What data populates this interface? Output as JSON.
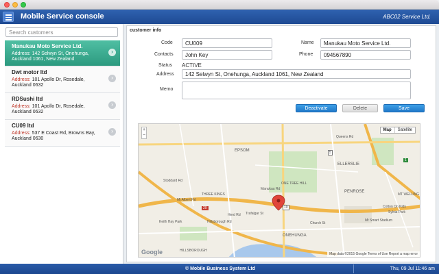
{
  "app": {
    "title": "Mobile Service console",
    "company": "ABC02 Service Ltd."
  },
  "sidebar": {
    "search_placeholder": "Search customers",
    "address_label": "Address:",
    "customers": [
      {
        "name": "Manukau Moto Service Ltd.",
        "address": "142 Selwyn St, Onehunga, Auckland 1061, New Zealand"
      },
      {
        "name": "Dwt motor ltd",
        "address": "101 Apollo Dr, Rosedale, Auckland 0632"
      },
      {
        "name": "RDSushi ltd",
        "address": "101 Apollo Dr, Rosedale, Auckland 0632"
      },
      {
        "name": "CU09 ltd",
        "address": "537 E Coast Rd, Browns Bay, Auckland 0630"
      }
    ]
  },
  "customer_info": {
    "section_title": "customer info",
    "code_label": "Code",
    "code": "CU009",
    "name_label": "Name",
    "name": "Manukau Moto Service Ltd.",
    "contacts_label": "Contacts",
    "contacts": "John Key",
    "phone_label": "Phone",
    "phone": "094567890",
    "status_label": "Status",
    "status": "ACTIVE",
    "address_label": "Address",
    "address": "142 Selwyn St, Onehunga, Auckland 1061, New Zealand",
    "memo_label": "Memo",
    "memo": ""
  },
  "actions": {
    "deactivate": "Deactivate",
    "delete": "Delete",
    "save": "Save"
  },
  "map": {
    "type_map": "Map",
    "type_satellite": "Satellite",
    "zoom_in": "+",
    "zoom_out": "−",
    "google": "Google",
    "footer": "Map data ©2015 Google   Terms of Use   Report a map error",
    "labels": {
      "epsom": "EPSOM",
      "ellerslie": "ELLERSLIE",
      "onehunga": "ONEHUNGA",
      "penrose": "PENROSE",
      "one_tree_hill": "ONE TREE HILL",
      "three_kings": "THREE KINGS",
      "hillsborough": "HILLSBOROUGH",
      "mt_smart": "Mt Smart Stadium",
      "cotton_on": "Cotton On Kids",
      "sylvia_park": "Sylvia Park",
      "mt_wellington": "MT WELLING",
      "keith_hay_park": "Keith Hay Park",
      "manukau_rd": "Manukau Rd",
      "queens_rd": "Queens Rd",
      "mt_albert_rd": "Mt Albert Rd",
      "hillsborough_rd": "Hillsborough Rd",
      "trafalgar_st": "Trafalgar St",
      "herd_rd": "Herd Rd",
      "church_st": "Church St",
      "stoddard_rd": "Stoddard Rd",
      "route_1": "1",
      "route_20": "20",
      "route_10": "10",
      "route_5": "5"
    }
  },
  "statusbar": {
    "footer": "© Mobile Business System Ltd",
    "datetime": "Thu, 09 Jul 11:46 am"
  },
  "colors": {
    "appbar": "#2f62b0",
    "active_item": "#3cae92",
    "accent_blue": "#1f78c8",
    "address_red": "#c0392b"
  }
}
